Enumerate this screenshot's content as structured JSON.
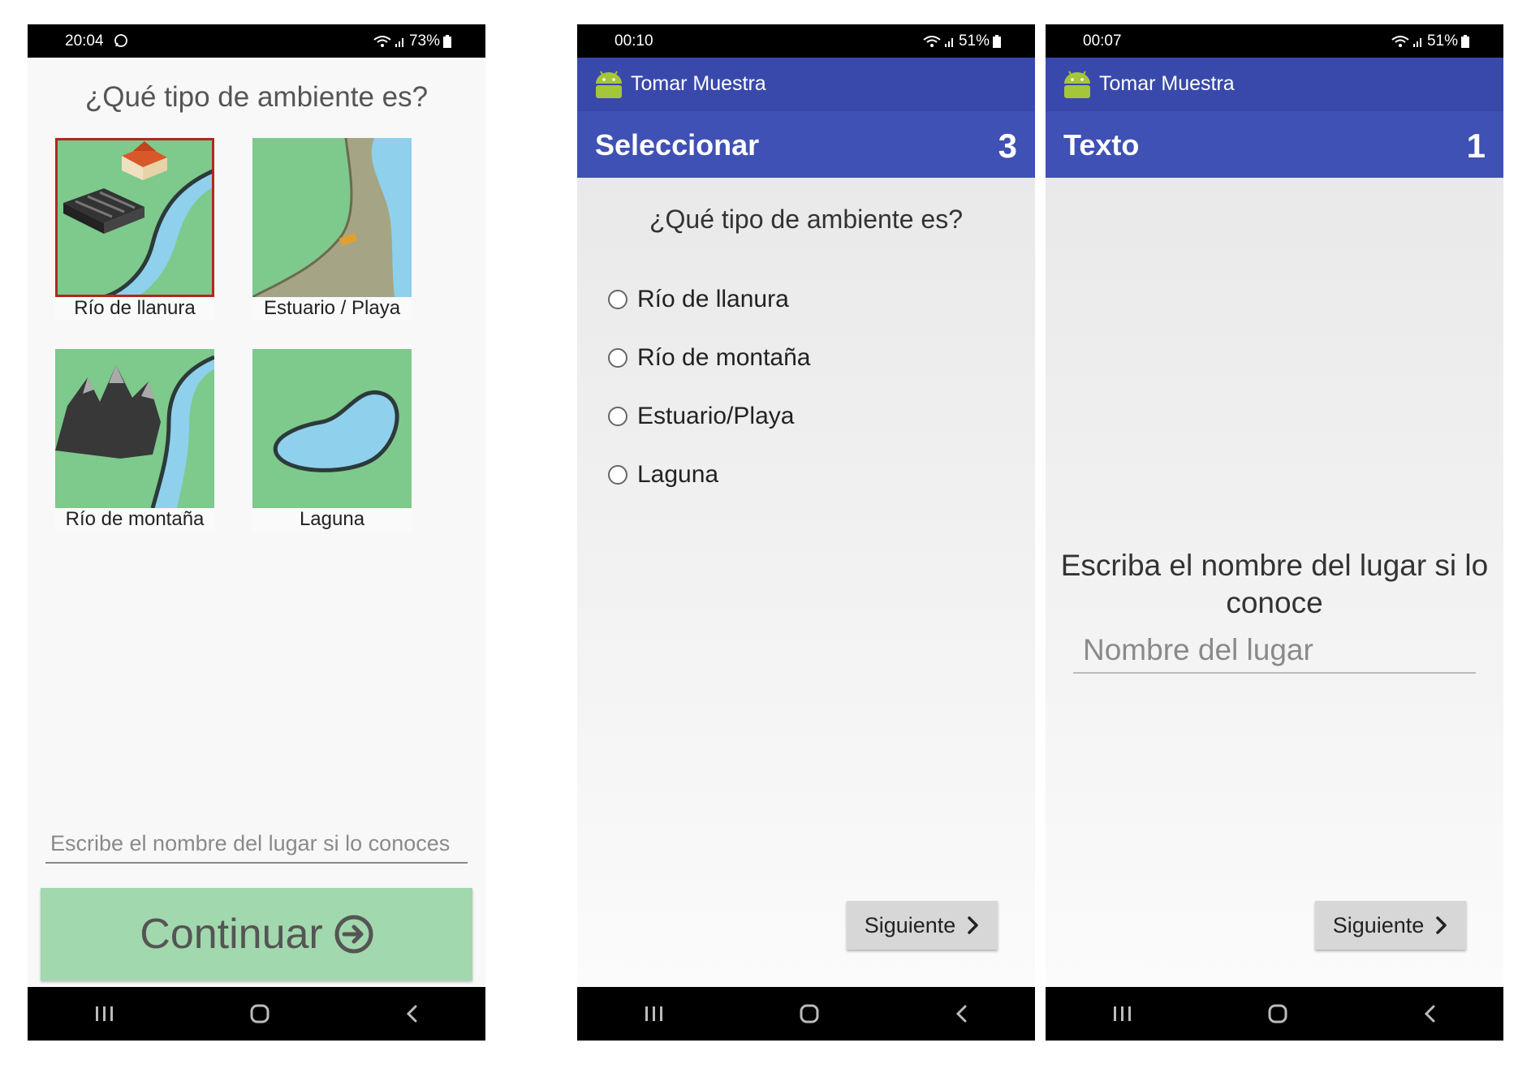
{
  "phones": {
    "p1": {
      "time": "20:04",
      "battery": "73%",
      "question": "¿Qué tipo de ambiente es?",
      "options": [
        "Río de llanura",
        "Estuario / Playa",
        "Río de montaña",
        "Laguna"
      ],
      "selected_option": "Río de llanura",
      "input_placeholder": "Escribe el nombre del lugar si lo conoces",
      "continue_label": "Continuar"
    },
    "p2": {
      "time": "00:10",
      "battery": "51%",
      "app_title": "Tomar Muestra",
      "sub_title": "Seleccionar",
      "sub_count": "3",
      "question": "¿Qué tipo de ambiente es?",
      "radio_options": [
        "Río de llanura",
        "Río de montaña",
        "Estuario/Playa",
        "Laguna"
      ],
      "next_label": "Siguiente"
    },
    "p3": {
      "time": "00:07",
      "battery": "51%",
      "app_title": "Tomar Muestra",
      "sub_title": "Texto",
      "sub_count": "1",
      "prompt_line1": "Escriba el nombre del lugar si lo",
      "prompt_line2": "conoce",
      "input_placeholder": "Nombre del lugar",
      "next_label": "Siguiente"
    }
  },
  "colors": {
    "appbar": "#3949ab",
    "subbar": "#3f51b5",
    "tile_green": "#7ec98c",
    "continue_button": "#a2d8ad",
    "selected_outline": "#b3261e",
    "water": "#8fd0ec"
  },
  "icons": {
    "status": [
      "wifi-icon",
      "signal-icon",
      "battery-icon"
    ],
    "navbar": [
      "recent-apps-icon",
      "home-icon",
      "back-icon"
    ],
    "continue": "arrow-circle-right-icon",
    "next": "chevron-right-icon",
    "app": "android-icon"
  }
}
